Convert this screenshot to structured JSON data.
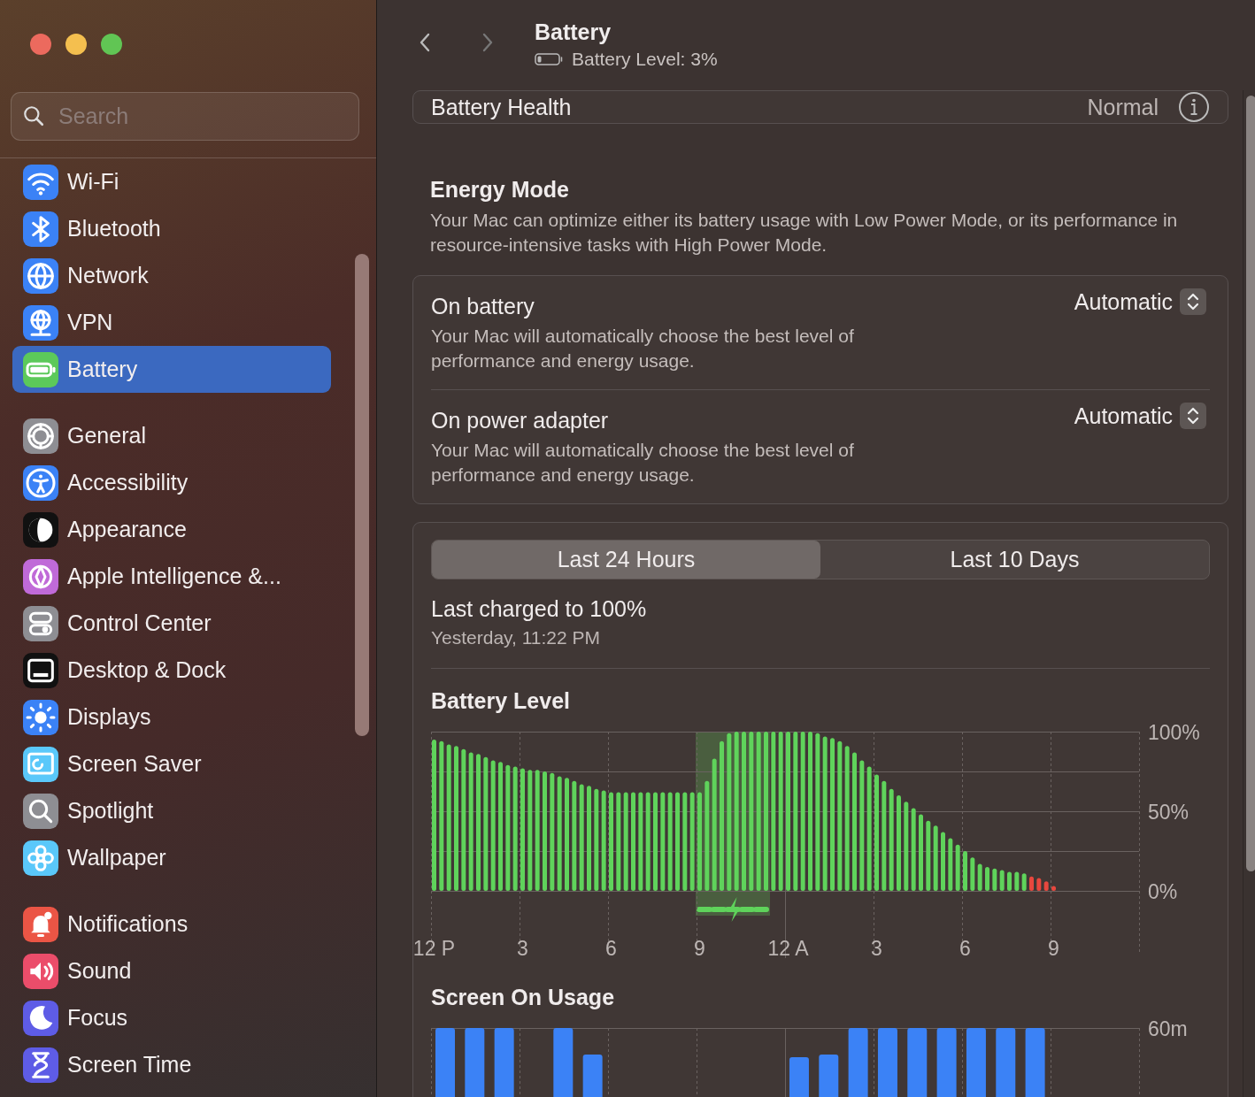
{
  "sidebar": {
    "search": {
      "placeholder": "Search"
    },
    "groups": [
      {
        "items": [
          {
            "label": "Wi-Fi",
            "selected": false
          },
          {
            "label": "Bluetooth",
            "selected": false
          },
          {
            "label": "Network",
            "selected": false
          },
          {
            "label": "VPN",
            "selected": false
          },
          {
            "label": "Battery",
            "selected": true
          }
        ]
      },
      {
        "items": [
          {
            "label": "General",
            "selected": false
          },
          {
            "label": "Accessibility",
            "selected": false
          },
          {
            "label": "Appearance",
            "selected": false
          },
          {
            "label": "Apple Intelligence &...",
            "selected": false
          },
          {
            "label": "Control Center",
            "selected": false
          },
          {
            "label": "Desktop & Dock",
            "selected": false
          },
          {
            "label": "Displays",
            "selected": false
          },
          {
            "label": "Screen Saver",
            "selected": false
          },
          {
            "label": "Spotlight",
            "selected": false
          },
          {
            "label": "Wallpaper",
            "selected": false
          }
        ]
      },
      {
        "items": [
          {
            "label": "Notifications",
            "selected": false
          },
          {
            "label": "Sound",
            "selected": false
          },
          {
            "label": "Focus",
            "selected": false
          },
          {
            "label": "Screen Time",
            "selected": false
          }
        ]
      }
    ]
  },
  "header": {
    "title": "Battery",
    "subtitle": "Battery Level: 3%"
  },
  "health": {
    "label": "Battery Health",
    "value": "Normal"
  },
  "energy_mode": {
    "title": "Energy Mode",
    "description": "Your Mac can optimize either its battery usage with Low Power Mode, or its performance in resource-intensive tasks with High Power Mode.",
    "options": [
      {
        "label": "On battery",
        "description": "Your Mac will automatically choose the best level of performance and energy usage.",
        "value": "Automatic"
      },
      {
        "label": "On power adapter",
        "description": "Your Mac will automatically choose the best level of performance and energy usage.",
        "value": "Automatic"
      }
    ]
  },
  "usage": {
    "tabs": [
      {
        "label": "Last 24 Hours",
        "selected": true
      },
      {
        "label": "Last 10 Days",
        "selected": false
      }
    ],
    "last_charged": {
      "title": "Last charged to 100%",
      "time": "Yesterday, 11:22 PM"
    },
    "battery_level": {
      "title": "Battery Level",
      "chart_data": {
        "type": "bar",
        "stacked": true,
        "ylim": [
          0,
          100
        ],
        "categories": [
          "12 P",
          null,
          null,
          null,
          null,
          null,
          null,
          null,
          null,
          null,
          null,
          null,
          "3",
          null,
          null,
          null,
          null,
          null,
          null,
          null,
          null,
          null,
          null,
          null,
          "6",
          null,
          null,
          null,
          null,
          null,
          null,
          null,
          null,
          null,
          null,
          null,
          "9",
          null,
          null,
          null,
          null,
          null,
          null,
          null,
          null,
          null,
          null,
          null,
          "12 A",
          null,
          null,
          null,
          null,
          null,
          null,
          null,
          null,
          null,
          null,
          null,
          "3",
          null,
          null,
          null,
          null,
          null,
          null,
          null,
          null,
          null,
          null,
          null,
          "6",
          null,
          null,
          null,
          null,
          null,
          null,
          null,
          null,
          null,
          null,
          null,
          "9"
        ],
        "series": [
          {
            "color": "#5fd35b",
            "values": [
              95,
              94,
              92,
              91,
              89,
              87,
              86,
              84,
              82,
              81,
              79,
              78,
              77,
              76,
              76,
              75,
              74,
              72,
              71,
              69,
              67,
              66,
              64,
              63,
              62,
              62,
              62,
              62,
              62,
              62,
              62,
              62,
              62,
              62,
              62,
              62,
              62,
              69,
              83,
              94,
              99,
              100,
              100,
              100,
              100,
              100,
              100,
              100,
              100,
              100,
              100,
              100,
              99,
              97,
              96,
              94,
              91,
              87,
              82,
              78,
              73,
              69,
              64,
              60,
              56,
              52,
              48,
              44,
              41,
              37,
              33,
              29,
              25,
              21,
              17,
              15,
              14,
              13,
              12,
              12,
              11,
              null,
              null,
              null,
              null
            ]
          },
          {
            "color": "#e8473e",
            "values": [
              null,
              null,
              null,
              null,
              null,
              null,
              null,
              null,
              null,
              null,
              null,
              null,
              null,
              null,
              null,
              null,
              null,
              null,
              null,
              null,
              null,
              null,
              null,
              null,
              null,
              null,
              null,
              null,
              null,
              null,
              null,
              null,
              null,
              null,
              null,
              null,
              null,
              null,
              null,
              null,
              null,
              null,
              null,
              null,
              null,
              null,
              null,
              null,
              null,
              null,
              null,
              null,
              null,
              null,
              null,
              null,
              null,
              null,
              null,
              null,
              null,
              null,
              null,
              null,
              null,
              null,
              null,
              null,
              null,
              null,
              null,
              null,
              null,
              null,
              null,
              null,
              null,
              null,
              null,
              null,
              null,
              9,
              8,
              6,
              3
            ]
          }
        ],
        "yticks": [
          {
            "value": 0,
            "label": "0%"
          },
          {
            "value": 50,
            "label": "50%"
          },
          {
            "value": 100,
            "label": "100%"
          }
        ]
      }
    },
    "screen_on_usage": {
      "title": "Screen On Usage",
      "scale_label": "60m"
    }
  }
}
